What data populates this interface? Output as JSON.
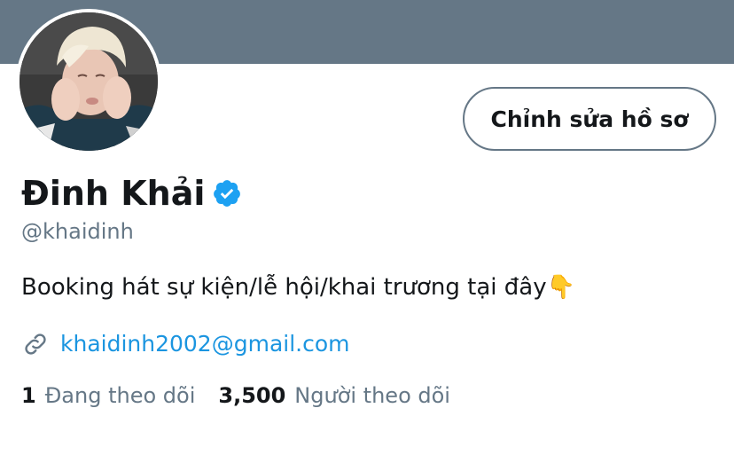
{
  "colors": {
    "banner": "#657786",
    "accent": "#1b95e0",
    "verified": "#1da1f2",
    "text": "#14171a",
    "muted": "#657786"
  },
  "profile": {
    "name": "Đinh Khải",
    "handle": "@khaidinh",
    "bio": "Booking hát sự kiện/lễ hội/khai trương tại đây👇",
    "link": "khaidinh2002@gmail.com",
    "verified": true
  },
  "actions": {
    "edit_label": "Chỉnh sửa hồ sơ"
  },
  "stats": {
    "following_count": "1",
    "following_label": "Đang theo dõi",
    "followers_count": "3,500",
    "followers_label": "Người theo dõi"
  },
  "icons": {
    "verified": "verified-badge-icon",
    "link": "link-icon"
  }
}
